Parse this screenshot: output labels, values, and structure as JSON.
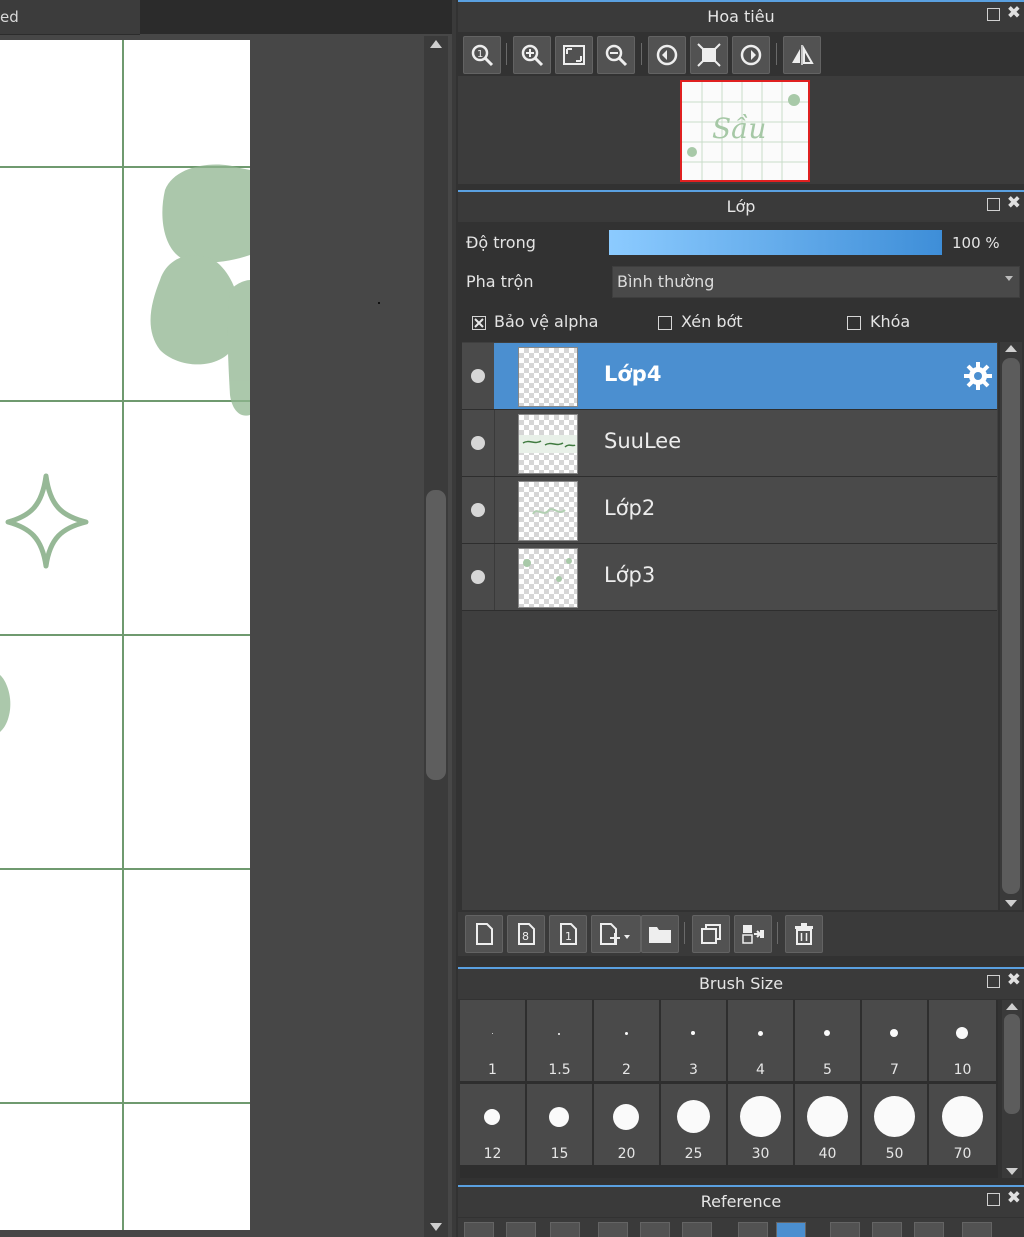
{
  "document": {
    "tab_label": "ed"
  },
  "navigator": {
    "title": "Hoa tiêu",
    "thumbnail_text": "Sầu"
  },
  "layer_panel": {
    "title": "Lớp",
    "opacity_label": "Độ trong",
    "opacity_value": "100 %",
    "opacity_fraction": 1.0,
    "blend_label": "Pha trộn",
    "blend_value": "Bình thường",
    "protect_alpha_label": "Bảo vệ alpha",
    "protect_alpha_checked": true,
    "clipping_label": "Xén bớt",
    "clipping_checked": false,
    "lock_label": "Khóa",
    "lock_checked": false,
    "layers": [
      {
        "name": "Lớp4",
        "selected": true
      },
      {
        "name": "SuuLee",
        "selected": false
      },
      {
        "name": "Lớp2",
        "selected": false
      },
      {
        "name": "Lớp3",
        "selected": false
      }
    ]
  },
  "brush_size": {
    "title": "Brush Size",
    "sizes": [
      "1",
      "1.5",
      "2",
      "3",
      "4",
      "5",
      "7",
      "10",
      "12",
      "15",
      "20",
      "25",
      "30",
      "40",
      "50",
      "70"
    ]
  },
  "reference": {
    "title": "Reference"
  },
  "icons": [
    "zoom-actual-icon",
    "zoom-in-icon",
    "fit-window-icon",
    "zoom-out-icon",
    "rotate-left-icon",
    "reset-view-icon",
    "rotate-right-icon",
    "flip-horizontal-icon",
    "gear-icon",
    "new-layer-icon",
    "new-8bit-layer-icon",
    "new-1bit-layer-icon",
    "add-layer-menu-icon",
    "folder-icon",
    "duplicate-icon",
    "merge-down-icon",
    "trash-icon"
  ],
  "colors": {
    "accent": "#4b8fd0",
    "nav_frame": "#e02020",
    "grid": "#6f9a6f"
  }
}
